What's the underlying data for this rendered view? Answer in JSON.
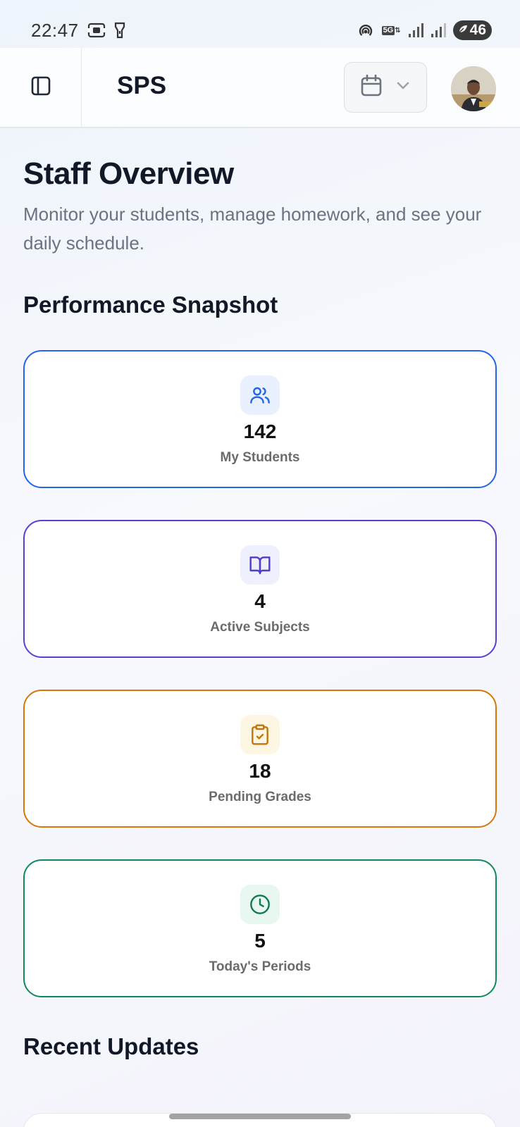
{
  "status_bar": {
    "time": "22:47",
    "network_label": "5G",
    "battery_level": "46",
    "icons": [
      "screen-record-icon",
      "flashlight-icon",
      "hotspot-icon",
      "signal-icon",
      "battery-icon"
    ]
  },
  "header": {
    "app_title": "SPS",
    "icons": [
      "sidebar-toggle-icon",
      "calendar-icon",
      "chevron-down-icon"
    ]
  },
  "page": {
    "title": "Staff Overview",
    "subtitle": "Monitor your students, manage homework, and see your daily schedule."
  },
  "performance": {
    "section_title": "Performance Snapshot",
    "cards": [
      {
        "value": "142",
        "label": "My Students",
        "icon": "users-icon",
        "color": "#2563eb",
        "icon_bg": "#eaf1fe"
      },
      {
        "value": "4",
        "label": "Active Subjects",
        "icon": "book-open-icon",
        "color": "#5b3fd4",
        "icon_bg": "#eef0fd"
      },
      {
        "value": "18",
        "label": "Pending Grades",
        "icon": "clipboard-check-icon",
        "color": "#d97706",
        "icon_bg": "#fdf6e3"
      },
      {
        "value": "5",
        "label": "Today's Periods",
        "icon": "clock-icon",
        "color": "#0f8a5f",
        "icon_bg": "#e8f8f0"
      }
    ]
  },
  "updates": {
    "section_title": "Recent Updates"
  }
}
